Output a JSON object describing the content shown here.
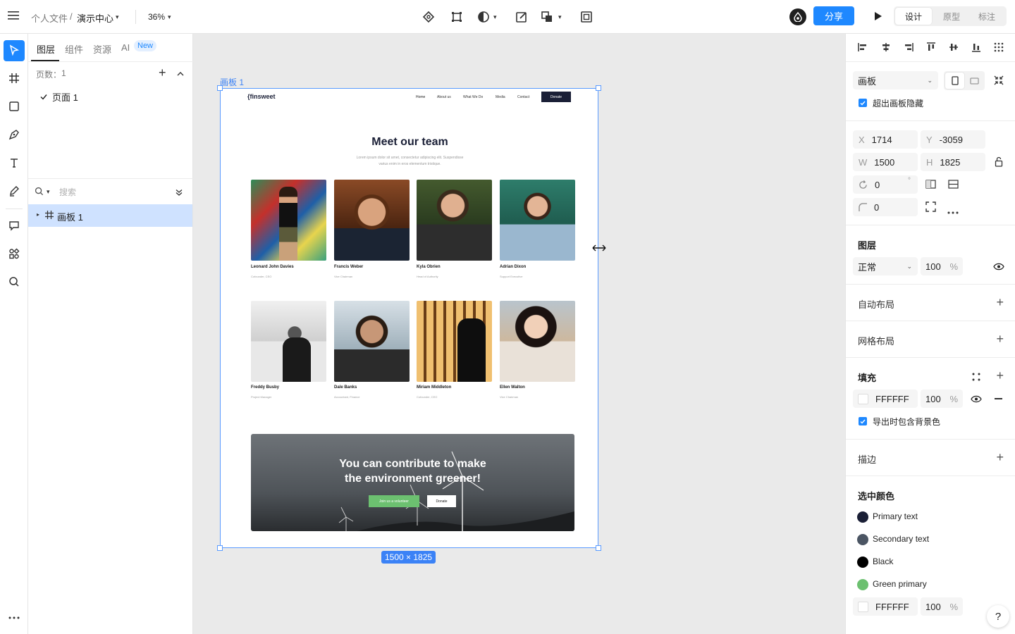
{
  "topbar": {
    "breadcrumb_parent": "个人文件",
    "breadcrumb_sep": "/",
    "breadcrumb_current": "演示中心",
    "zoom": "36%",
    "share_label": "分享",
    "mode_tabs": [
      "设计",
      "原型",
      "标注"
    ]
  },
  "left_panel": {
    "tabs": [
      "图层",
      "组件",
      "资源",
      "AI"
    ],
    "ai_badge": "New",
    "pages_label": "页数：",
    "pages_count": "1",
    "page_item": "页面 1",
    "search_placeholder": "搜索",
    "layer_item": "画板 1"
  },
  "canvas": {
    "artboard_label": "画板 1",
    "size_badge": "1500 × 1825",
    "site": {
      "logo": "{finsweet",
      "nav": [
        "Home",
        "About us",
        "What We Do",
        "Media",
        "Contact"
      ],
      "nav_button": "Donate",
      "heading": "Meet our team",
      "subheading_line1": "Lorem ipsum dolor sit amet, consectetur adipiscing elit. Suspendisse",
      "subheading_line2": "varius enim in eros elementum tristique.",
      "members": [
        {
          "name": "Leonard John Davies",
          "role": "Cofounder, CEO"
        },
        {
          "name": "Francis Weber",
          "role": "Vice Chairman"
        },
        {
          "name": "Kyla Obrien",
          "role": "Head of Authority"
        },
        {
          "name": "Adrian Dixon",
          "role": "Support Executive"
        },
        {
          "name": "Freddy Busby",
          "role": "Project Manager"
        },
        {
          "name": "Dale Banks",
          "role": "Accountant, Finance"
        },
        {
          "name": "Miriam Middleton",
          "role": "Cofounder, CEO"
        },
        {
          "name": "Ellen Walton",
          "role": "Vice Chairman"
        }
      ],
      "cta_line1": "You can contribute to make",
      "cta_line2": "the environment greener!",
      "cta_btn_primary": "Join us a volunteer",
      "cta_btn_secondary": "Donate"
    }
  },
  "right_panel": {
    "frame_select": "画板",
    "clip_label": "超出画板隐藏",
    "x_label": "X",
    "x_value": "1714",
    "y_label": "Y",
    "y_value": "-3059",
    "w_label": "W",
    "w_value": "1500",
    "h_label": "H",
    "h_value": "1825",
    "rotation_value": "0",
    "rotation_unit": "°",
    "radius_value": "0",
    "layer_title": "图层",
    "blend_mode": "正常",
    "opacity_value": "100",
    "percent": "%",
    "auto_layout_title": "自动布局",
    "grid_layout_title": "网格布局",
    "fill_title": "填充",
    "fill_hex": "FFFFFF",
    "fill_opacity": "100",
    "export_bg_label": "导出时包含背景色",
    "stroke_title": "描边",
    "selected_colors_title": "选中颜色",
    "selected_colors": [
      {
        "name": "Primary text",
        "color": "#1a1f36"
      },
      {
        "name": "Secondary text",
        "color": "#4b5563"
      },
      {
        "name": "Black",
        "color": "#000000"
      },
      {
        "name": "Green primary",
        "color": "#6cc070"
      }
    ],
    "selected_hex": "FFFFFF",
    "selected_opacity": "100",
    "help": "?"
  },
  "colors": {
    "accent": "#1e88ff",
    "artboard_border": "#5a9bff"
  }
}
